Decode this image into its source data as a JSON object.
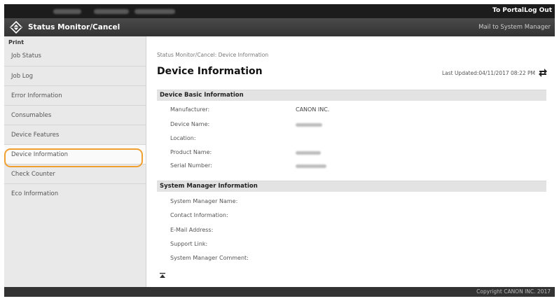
{
  "header": {
    "portal_link": "To Portal",
    "logout_link": "Log Out",
    "app_title": "Status Monitor/Cancel",
    "mail_link": "Mail to System Manager"
  },
  "sidebar": {
    "section_label": "Print",
    "items": [
      {
        "label": "Job Status"
      },
      {
        "label": "Job Log"
      },
      {
        "label": "Error Information"
      },
      {
        "label": "Consumables"
      },
      {
        "label": "Device Features"
      },
      {
        "label": "Device Information",
        "selected": true
      },
      {
        "label": "Check Counter"
      },
      {
        "label": "Eco Information"
      }
    ]
  },
  "main": {
    "breadcrumb": "Status Monitor/Cancel: Device Information",
    "page_title": "Device Information",
    "last_updated": "Last Updated:04/11/2017 08:22 PM",
    "basic": {
      "heading": "Device Basic Information",
      "fields": [
        {
          "label": "Manufacturer:",
          "value": "CANON INC."
        },
        {
          "label": "Device Name:",
          "value": ""
        },
        {
          "label": "Location:",
          "value": ""
        },
        {
          "label": "Product Name:",
          "value": ""
        },
        {
          "label": "Serial Number:",
          "value": ""
        }
      ]
    },
    "manager": {
      "heading": "System Manager Information",
      "fields": [
        {
          "label": "System Manager Name:"
        },
        {
          "label": "Contact Information:"
        },
        {
          "label": "E-Mail Address:"
        },
        {
          "label": "Support Link:"
        },
        {
          "label": "System Manager Comment:"
        }
      ]
    },
    "to_top_icon": "to-top-icon"
  },
  "footer": {
    "copyright": "Copyright CANON INC. 2017"
  },
  "colors": {
    "highlight": "#f0a030",
    "topbar": "#1c1c1c",
    "titlebar": "#3c3c3c"
  }
}
